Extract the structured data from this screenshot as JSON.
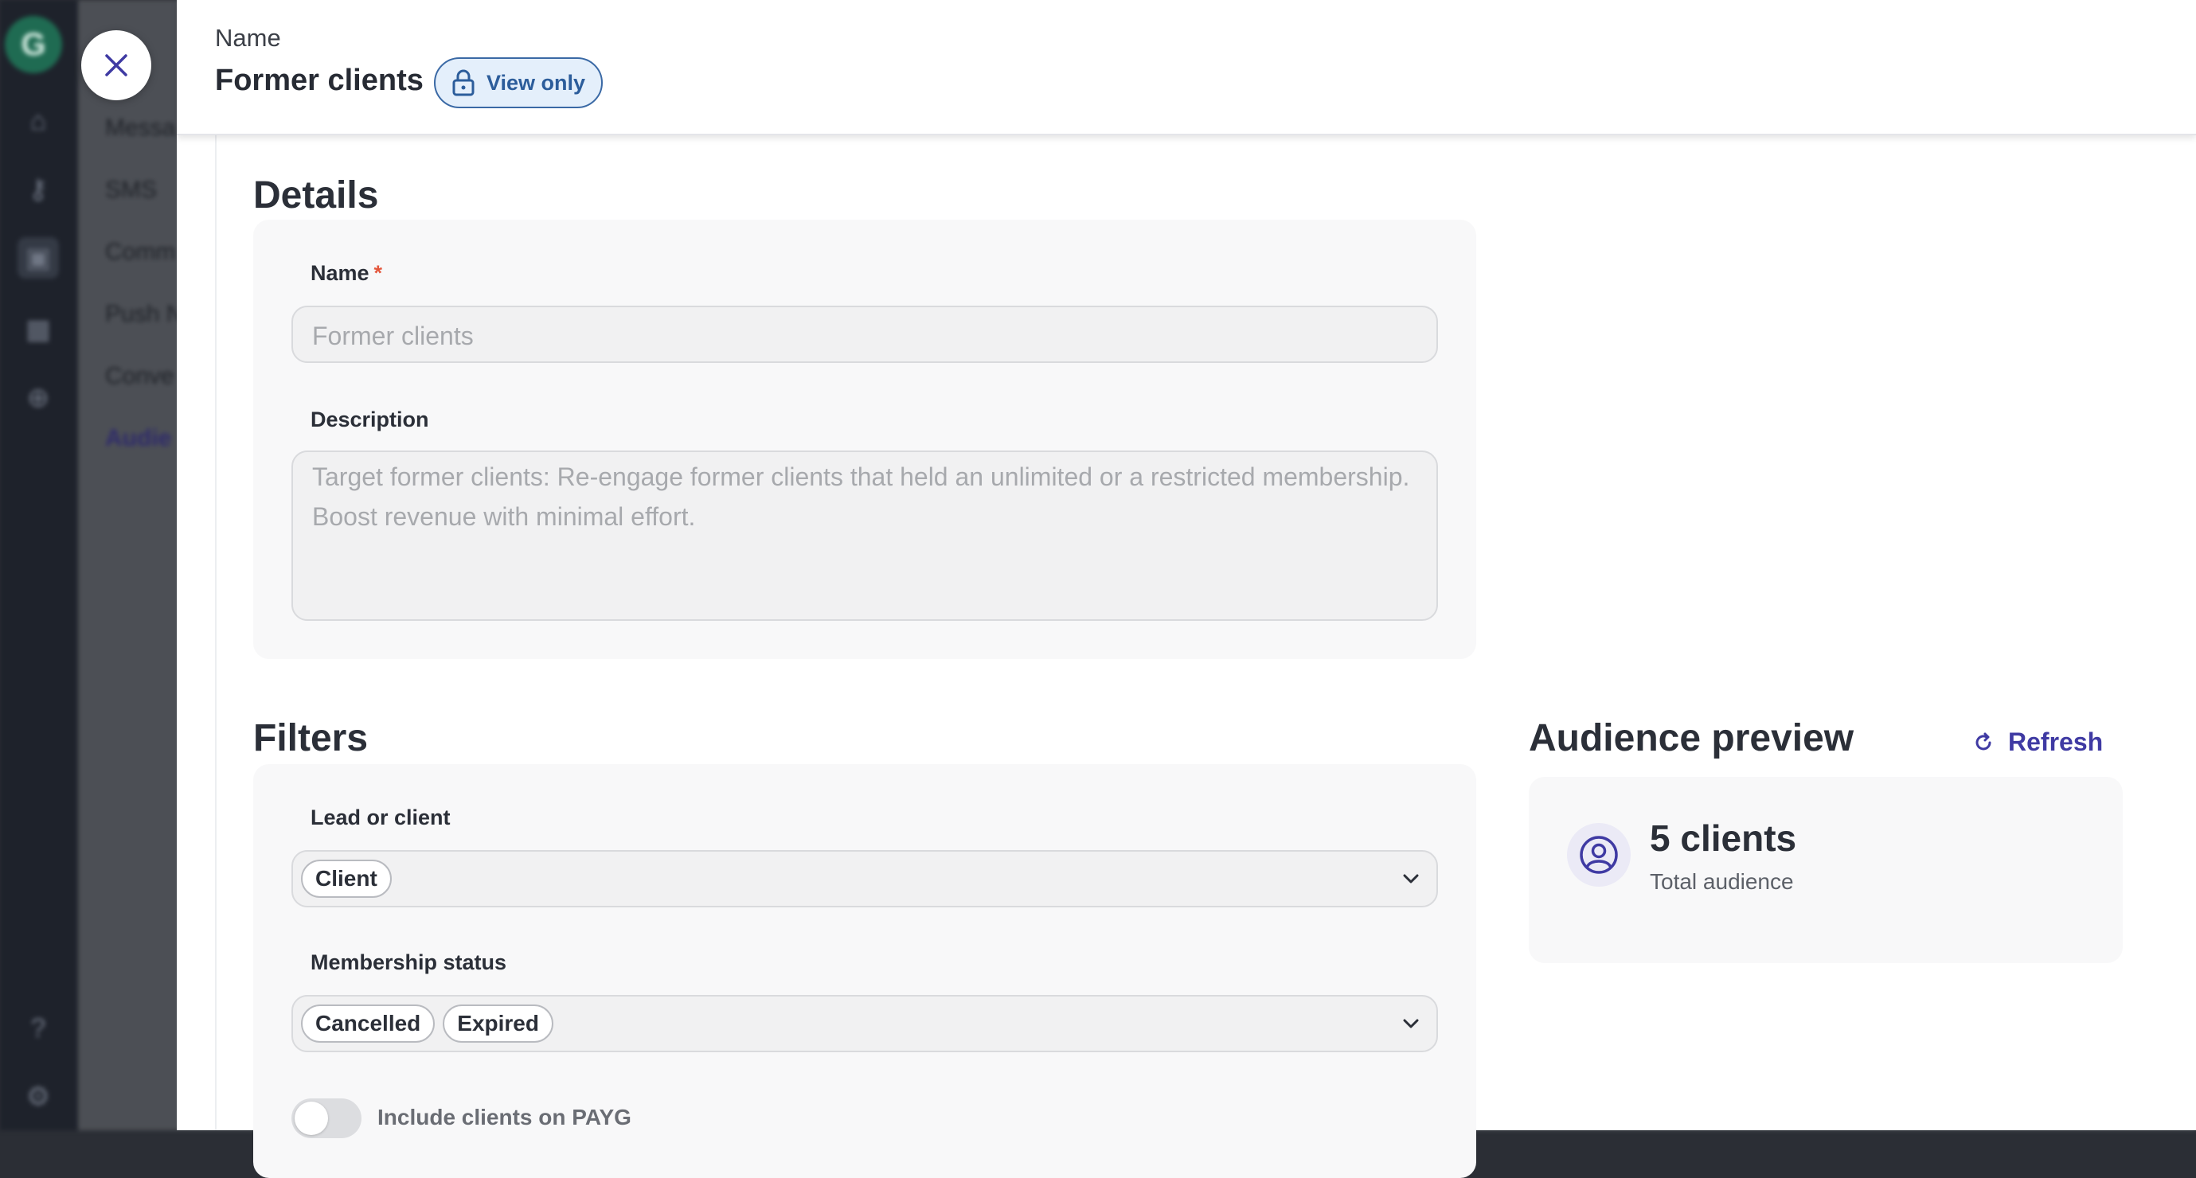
{
  "background": {
    "menu_items": [
      "Messa",
      "SMS",
      "Comm",
      "Push N",
      "Conve",
      "Audie"
    ],
    "active_menu_item": "Audie"
  },
  "header": {
    "caption": "Name",
    "title": "Former clients",
    "badge": "View only"
  },
  "details": {
    "section_title": "Details",
    "name_label": "Name",
    "required_mark": "*",
    "name_value": "Former clients",
    "description_label": "Description",
    "description_value": "Target former clients: Re-engage former clients that held an unlimited or a restricted membership. Boost revenue with minimal effort."
  },
  "filters": {
    "section_title": "Filters",
    "lead_or_client_label": "Lead or client",
    "lead_or_client_chips": [
      "Client"
    ],
    "membership_status_label": "Membership status",
    "membership_status_chips": [
      "Cancelled",
      "Expired"
    ],
    "payg_toggle_label": "Include clients on PAYG",
    "payg_toggle_on": false
  },
  "audience_preview": {
    "title": "Audience preview",
    "refresh_label": "Refresh",
    "count": "5 clients",
    "caption": "Total audience"
  },
  "colors": {
    "accent": "#3f3aa3",
    "badge_blue": "#2c5d9b",
    "required": "#e4573d"
  },
  "icons": {
    "close": "close-icon",
    "lock": "lock-icon",
    "refresh": "refresh-icon",
    "user": "user-circle-icon",
    "chevron": "chevron-down-icon"
  }
}
